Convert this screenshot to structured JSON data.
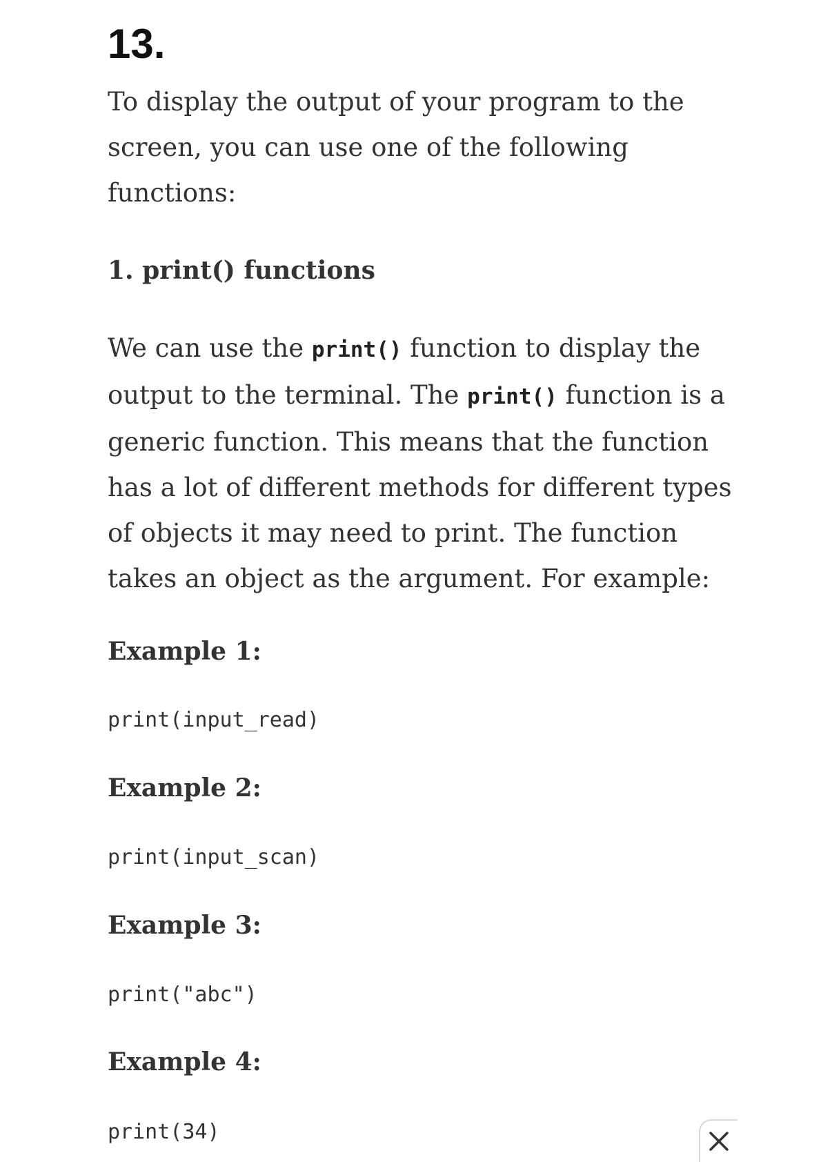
{
  "item_number": "13.",
  "intro": "To display the output of your program to the screen, you can use one of the following functions:",
  "section_heading": "1. print() functions",
  "body": {
    "part1": "We can use the ",
    "code1": "print()",
    "part2": " function to display the output to the terminal. The ",
    "code2": "print()",
    "part3": " function is a generic function. This means that the function has a lot of different methods for different types of objects it may need to print. The function takes an object as the argument. For example:"
  },
  "examples": [
    {
      "heading": "Example 1:",
      "code": "print(input_read)"
    },
    {
      "heading": "Example 2:",
      "code": "print(input_scan)"
    },
    {
      "heading": "Example 3:",
      "code": "print(\"abc\")"
    },
    {
      "heading": "Example 4:",
      "code": "print(34)"
    }
  ],
  "close_icon": "close-icon"
}
